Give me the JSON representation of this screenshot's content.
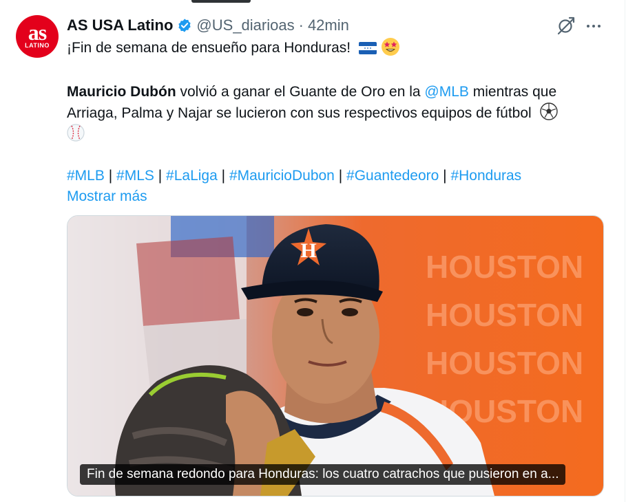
{
  "tweet": {
    "author_name": "AS USA Latino",
    "handle": "@US_diarioas",
    "time": "42min",
    "separator": "·",
    "avatar_top": "as",
    "avatar_bottom": "LATINO",
    "line1": "¡Fin de semana de ensueño para Honduras!",
    "line1_emojis": [
      "honduras-flag",
      "star-struck-emoji"
    ],
    "body_bold": "Mauricio Dubón",
    "body_p1": " volvió a ganar el Guante de Oro en la ",
    "mention": "@MLB",
    "body_p2": " mientras que",
    "body_line2": "Arriaga, Palma y Najar se lucieron con sus respectivos equipos de fútbol",
    "hashtags": [
      "#MLB",
      "#MLS",
      "#LaLiga",
      "#MauricioDubon",
      "#Guantedeoro",
      "#Honduras"
    ],
    "hashtag_separator": "|",
    "show_more": "Mostrar más",
    "media_caption": "Fin de semana redondo para Honduras: los cuatro catrachos que pusieron en a...",
    "media_logo_letter": "H"
  },
  "colors": {
    "link": "#1d9bf0",
    "brand_red": "#e3001b",
    "text": "#0f1419",
    "muted": "#536471"
  }
}
